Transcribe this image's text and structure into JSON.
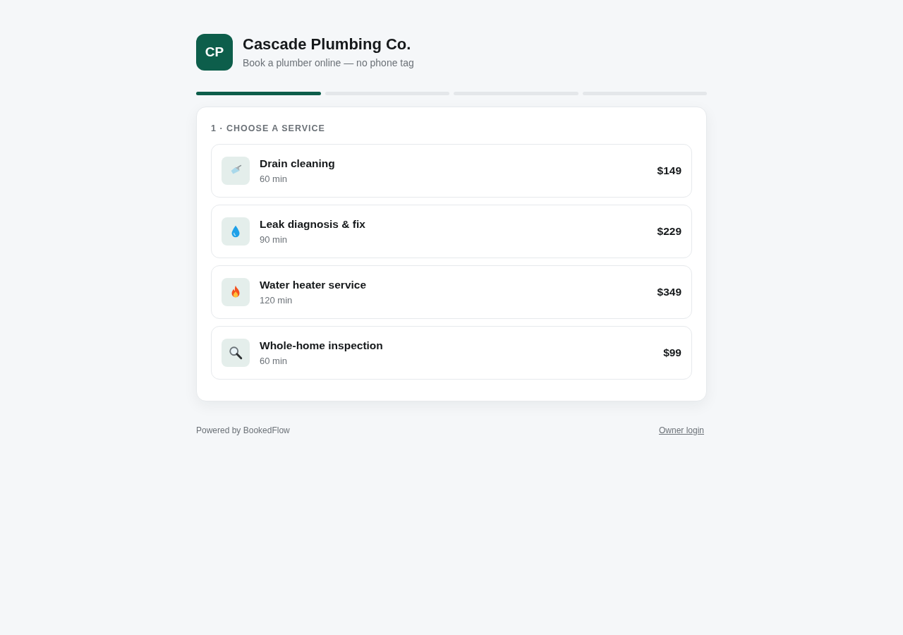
{
  "brand": {
    "initials": "CP",
    "name": "Cascade Plumbing Co.",
    "tagline": "Book a plumber online — no phone tag"
  },
  "steps": [
    {
      "completed": true
    },
    {
      "completed": false
    },
    {
      "completed": false
    },
    {
      "completed": false
    }
  ],
  "card": {
    "heading": "1 · CHOOSE A SERVICE",
    "services": [
      {
        "kind": "shower",
        "name": "Drain cleaning",
        "duration": "60 min",
        "price": "$149"
      },
      {
        "kind": "drop",
        "name": "Leak diagnosis & fix",
        "duration": "90 min",
        "price": "$229"
      },
      {
        "kind": "flame",
        "name": "Water heater service",
        "duration": "120 min",
        "price": "$349"
      },
      {
        "kind": "magnifier",
        "name": "Whole-home inspection",
        "duration": "60 min",
        "price": "$99"
      }
    ]
  },
  "footer": {
    "powered_by": "Powered by BookedFlow",
    "link": "Owner login"
  }
}
